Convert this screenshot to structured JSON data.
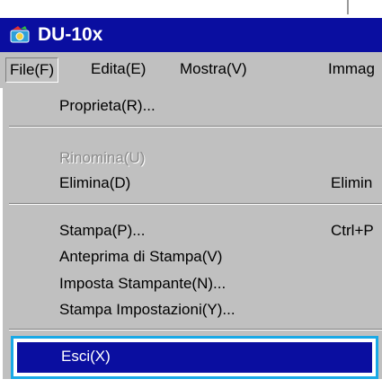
{
  "window": {
    "title": "DU-10x",
    "title_bar_color": "#0a0ea0",
    "icon": "app-icon"
  },
  "menubar": {
    "items": [
      {
        "label": "File(F)"
      },
      {
        "label": "Edita(E)"
      },
      {
        "label": "Mostra(V)"
      },
      {
        "label": "Immag"
      }
    ],
    "active": "File(F)"
  },
  "file_menu": {
    "properties": "Proprieta(R)...",
    "rename": "Rinomina(U)",
    "delete": "Elimina(D)",
    "delete_shortcut": "Elimin",
    "print": "Stampa(P)...",
    "print_shortcut": "Ctrl+P",
    "print_preview": "Anteprima di Stampa(V)",
    "printer_setup": "Imposta Stampante(N)...",
    "print_settings": "Stampa Impostazioni(Y)...",
    "exit": "Esci(X)"
  },
  "highlight_color": "#19a9e6"
}
